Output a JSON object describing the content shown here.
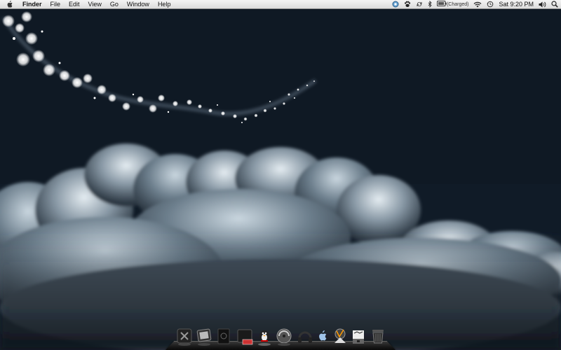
{
  "menubar": {
    "app_name": "Finder",
    "menus": [
      "File",
      "Edit",
      "View",
      "Go",
      "Window",
      "Help"
    ],
    "battery_status": "(Charged)",
    "clock": "Sat 9:20 PM"
  },
  "status_icons": [
    "spotlight-helper-icon",
    "paw-icon",
    "sync-icon",
    "bluetooth-icon",
    "battery-icon",
    "wifi-icon",
    "time-machine-icon",
    "volume-icon",
    "spotlight-icon"
  ],
  "dock": {
    "items": [
      "utility-app-icon",
      "photo-app-icon",
      "notebook-app-icon",
      "media-app-icon",
      "chat-app-icon",
      "cd-player-icon",
      "headphones-icon",
      "finder-icon",
      "textedit-icon",
      "preview-icon",
      "installer-icon",
      "trash-icon"
    ]
  },
  "colors": {
    "sky_top": "#0f1a26",
    "cloud_highlight": "#c9d6df",
    "menubar": "#e8e8e8"
  }
}
